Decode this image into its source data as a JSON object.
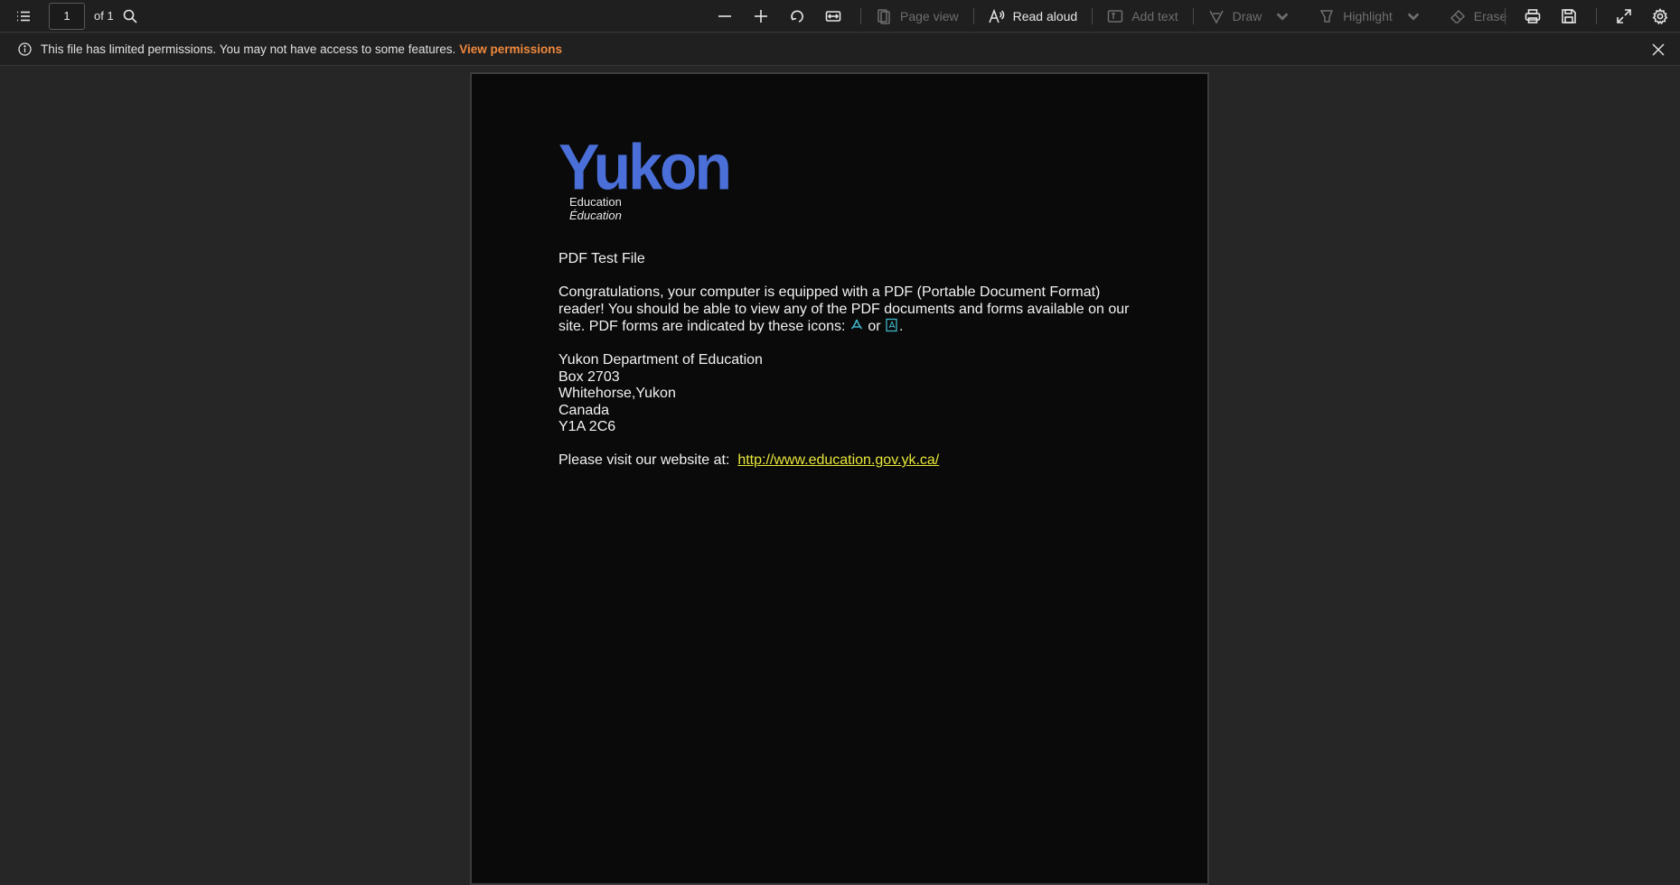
{
  "toolbar": {
    "page_number": "1",
    "page_of": "of 1",
    "page_view_label": "Page view",
    "read_aloud_label": "Read aloud",
    "add_text_label": "Add text",
    "draw_label": "Draw",
    "highlight_label": "Highlight",
    "erase_label": "Erase"
  },
  "infobar": {
    "message": "This file has limited permissions. You may not have access to some features.",
    "link_label": "View permissions"
  },
  "document": {
    "logo": {
      "word": "Yukon",
      "line1": "Education",
      "line2": "Éducation"
    },
    "title": "PDF Test File",
    "paragraph": "Congratulations, your computer is equipped with a PDF (Portable Document Format) reader!  You should be able to view any of the PDF documents and forms available on our site.  PDF forms are indicated by these icons: ",
    "icons_or": " or ",
    "icons_end": ".",
    "address": [
      "Yukon Department of Education",
      "Box 2703",
      "Whitehorse,Yukon",
      "Canada",
      "Y1A 2C6"
    ],
    "website_prefix": "Please visit our website at:  ",
    "website_url": "http://www.education.gov.yk.ca/"
  },
  "colors": {
    "logo_blue": "#4a6fd8",
    "link_yellow": "#e9e83a",
    "permission_orange": "#f0893d"
  }
}
